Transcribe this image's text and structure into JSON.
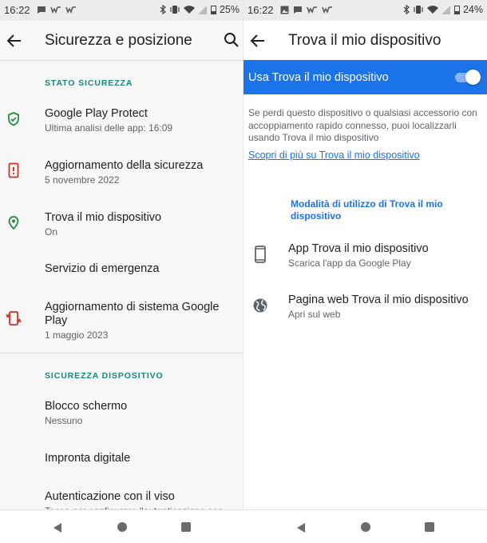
{
  "left": {
    "status_bar": {
      "time": "16:22",
      "battery": "25%"
    },
    "app_bar": {
      "title": "Sicurezza e posizione",
      "back_icon": "arrow-back-icon",
      "search_icon": "search-icon"
    },
    "section_stato": "STATO SICUREZZA",
    "items": [
      {
        "title": "Google Play Protect",
        "subtitle": "Ultima analisi delle app: 16:09",
        "icon": "shield-check-icon",
        "icon_color": "#1e8e3e"
      },
      {
        "title": "Aggiornamento della sicurezza",
        "subtitle": "5 novembre 2022",
        "icon": "phone-alert-icon",
        "icon_color": "#d93025"
      },
      {
        "title": "Trova il mio dispositivo",
        "subtitle": "On",
        "icon": "location-pin-icon",
        "icon_color": "#1e8e3e"
      },
      {
        "title": "Servizio di emergenza"
      },
      {
        "title": "Aggiornamento di sistema Google Play",
        "subtitle": "1 maggio 2023",
        "icon": "system-update-icon",
        "icon_color": "#d93025"
      }
    ],
    "section_dispositivo": "SICUREZZA DISPOSITIVO",
    "device_items": [
      {
        "title": "Blocco schermo",
        "subtitle": "Nessuno"
      },
      {
        "title": "Impronta digitale"
      },
      {
        "title": "Autenticazione con il viso",
        "subtitle": "Tocca per configurare l'autenticazione con"
      }
    ]
  },
  "right": {
    "status_bar": {
      "time": "16:22",
      "battery": "24%"
    },
    "app_bar": {
      "title": "Trova il mio dispositivo",
      "back_icon": "arrow-back-icon"
    },
    "toggle": {
      "label": "Usa Trova il mio dispositivo",
      "state": "on"
    },
    "description": "Se perdi questo dispositivo o qualsiasi accessorio con accoppiamento rapido connesso, puoi localizzarli usando Trova il mio dispositivo",
    "learn_more": "Scopri di più su Trova il mio dispositivo",
    "usage_header": "Modalità di utilizzo di Trova il mio dispositivo",
    "options": [
      {
        "title": "App Trova il mio dispositivo",
        "subtitle": "Scarica l'app da Google Play",
        "icon": "smartphone-icon"
      },
      {
        "title": "Pagina web Trova il mio dispositivo",
        "subtitle": "Apri sul web",
        "icon": "globe-icon"
      }
    ]
  },
  "colors": {
    "accent_blue": "#1a73e8",
    "section_teal": "#16897c",
    "green": "#1e8e3e",
    "red": "#d93025"
  }
}
